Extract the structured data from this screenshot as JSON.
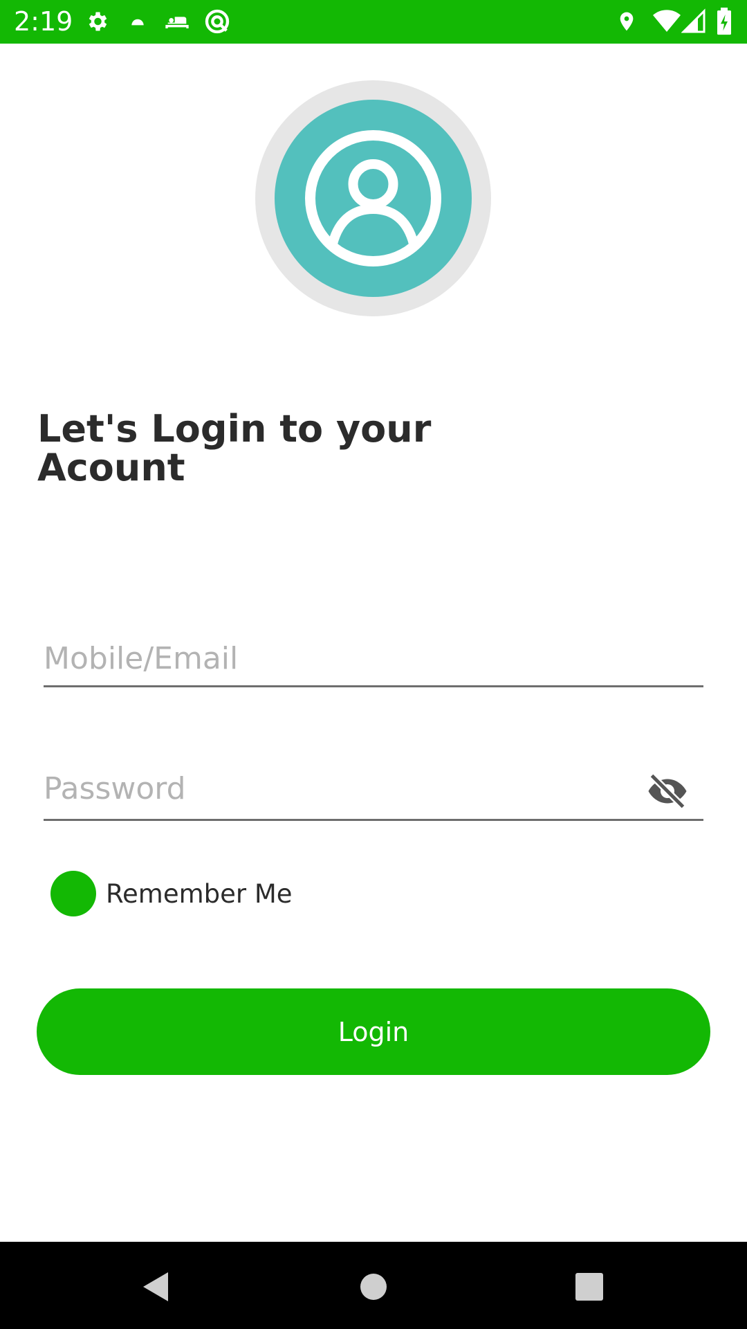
{
  "status_bar": {
    "time": "2:19",
    "left_icons": [
      "gear-icon",
      "android-icon",
      "bed-icon",
      "q-circle-icon"
    ],
    "right_icons": [
      "location-icon",
      "wifi-icon",
      "signal-icon",
      "battery-charging-icon"
    ],
    "background": "#13b804"
  },
  "avatar": {
    "icon": "user-circle-icon",
    "ring_color": "#e6e6e6",
    "fill_color": "#53c0bd"
  },
  "heading": "Let's Login to your Acount",
  "form": {
    "mobile_placeholder": "Mobile/Email",
    "mobile_value": "",
    "password_placeholder": "Password",
    "password_value": "",
    "password_toggle_icon": "eye-off-icon",
    "remember_label": "Remember Me",
    "login_label": "Login",
    "accent": "#13b804"
  },
  "nav_bar": {
    "buttons": [
      "back-icon",
      "home-icon",
      "recents-icon"
    ]
  }
}
